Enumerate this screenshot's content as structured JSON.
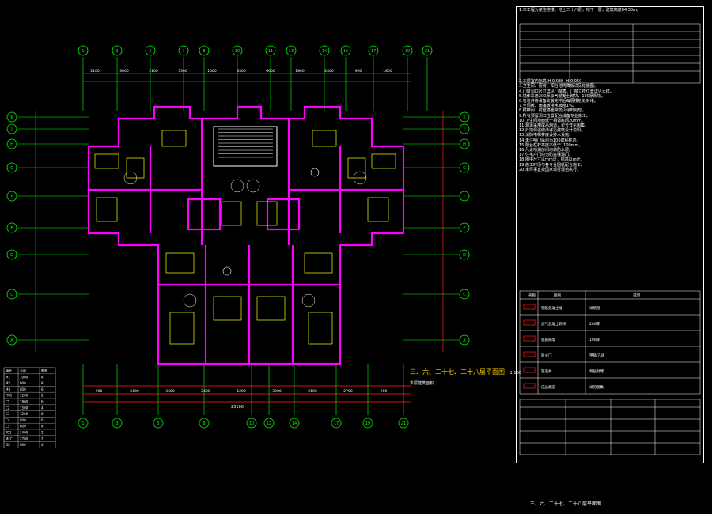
{
  "drawing": {
    "plan_title": "三、六、二十七、二十八层平面图",
    "plan_scale": "1:100",
    "plan_subtitle": "本层建筑面积",
    "sheet_title": "三、六、二十七、二十八层平面图",
    "top_axes": [
      "1",
      "3",
      "5",
      "7",
      "8",
      "10",
      "11",
      "13",
      "14",
      "16",
      "17",
      "19",
      "21"
    ],
    "bottom_axes": [
      "1",
      "3",
      "5",
      "8",
      "10",
      "12",
      "14",
      "17",
      "19",
      "21"
    ],
    "side_axes": [
      "K",
      "J",
      "H",
      "G",
      "F",
      "E",
      "D",
      "C",
      "A"
    ],
    "top_dims": [
      "2100",
      "3000",
      "2100",
      "3300",
      "1500",
      "3300",
      "6000",
      "1800",
      "2400",
      "900",
      "1800"
    ],
    "bottom_dims": [
      "900",
      "2400",
      "3300",
      "2400",
      "1200",
      "3900",
      "2100",
      "2700",
      "900"
    ],
    "overall_dim": "25100"
  },
  "notes": {
    "lines": [
      "1.本工程为某住宅楼，地上二十八层，地下一层，建筑高度84.30m。",
      "2.本层室内标高 H-0.030  H-0.050",
      "3.卫生间、厨房、阳台结构降板详见结施图。",
      "4.门窗洞口尺寸详见门窗表，门窗立樘位置详见大样。",
      "5.墙体采用200厚加气混凝土砌块，100厚隔墙。",
      "6.管道井待设备安装完毕后每层楼板处封堵。",
      "7.空调板、雨篷板排水坡度1%。",
      "8.楼梯间、前室墙面做防火涂料处理。",
      "9.所有预留洞口位置配合设备专业施工。",
      "10.卫生间地面低于相邻房间20mm。",
      "11.烟道采用成品烟道，型号详见图集。",
      "12.外墙保温做法详见建筑设计说明。",
      "13.消防电梯井底设排水设施。",
      "14.未注明门垛均为100或贴柱边。",
      "15.阳台栏杆高度不低于1100mm。",
      "16.凡设地漏房间均做防水层。",
      "17.住宅户门均为防盗保温门。",
      "18.图中尺寸以mm计，标高以m计。",
      "19.施工时须与各专业图纸配合施工。",
      "20.未尽事宜按国家现行规范执行。"
    ],
    "legend_header": [
      "名称",
      "图例",
      "说明"
    ],
    "legend_rows": [
      [
        "钢筋混凝土墙",
        "",
        "详结施"
      ],
      [
        "加气混凝土砌块",
        "",
        "200厚"
      ],
      [
        "轻质隔墙",
        "",
        "100厚"
      ],
      [
        "防火门",
        "",
        "甲级/乙级"
      ],
      [
        "管道井",
        "",
        "每层封堵"
      ],
      [
        "成品烟道",
        "",
        "详见图集"
      ]
    ]
  },
  "schedule": {
    "header": [
      "编号",
      "名称",
      "数量"
    ],
    "rows": [
      [
        "M1",
        "1000",
        "4"
      ],
      [
        "M2",
        "900",
        "8"
      ],
      [
        "M3",
        "800",
        "6"
      ],
      [
        "FM1",
        "1200",
        "2"
      ],
      [
        "C1",
        "1800",
        "6"
      ],
      [
        "C2",
        "1500",
        "4"
      ],
      [
        "C3",
        "1200",
        "8"
      ],
      [
        "C4",
        "900",
        "6"
      ],
      [
        "C5",
        "600",
        "4"
      ],
      [
        "TC1",
        "2400",
        "2"
      ],
      [
        "MLC",
        "2700",
        "2"
      ],
      [
        "GC",
        "600",
        "4"
      ]
    ]
  },
  "colors": {
    "grid": "#00ff00",
    "wall": "#ff00ff",
    "equip": "#ffff00",
    "dim": "#00ffff",
    "accent": "#ff2020",
    "text": "#ffffff"
  }
}
